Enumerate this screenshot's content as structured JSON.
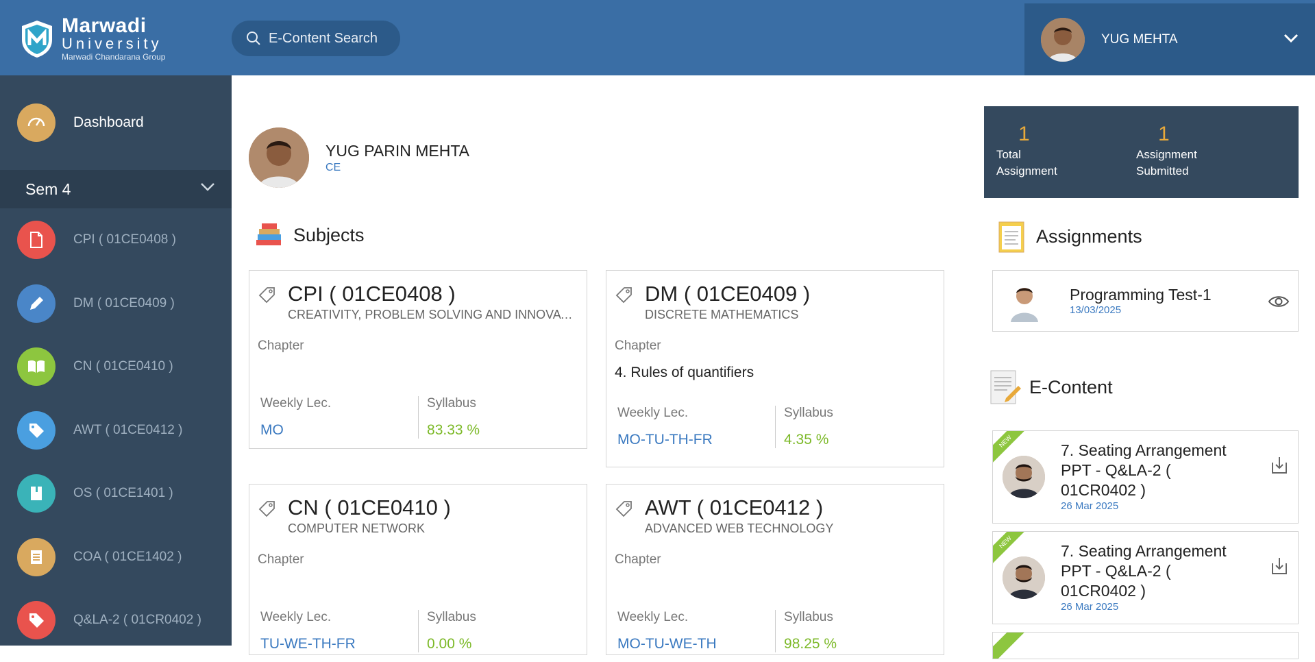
{
  "brand": {
    "name": "Marwadi",
    "subname": "University",
    "group": "Marwadi Chandarana Group"
  },
  "search": {
    "label": "E-Content Search"
  },
  "user_menu": {
    "name": "YUG MEHTA"
  },
  "sidebar": {
    "dashboard_label": "Dashboard",
    "semester_label": "Sem 4",
    "subjects": [
      {
        "label": "CPI ( 01CE0408 )",
        "color": "#e9534d",
        "icon": "document-icon"
      },
      {
        "label": "DM ( 01CE0409 )",
        "color": "#4a86c8",
        "icon": "pencil-icon"
      },
      {
        "label": "CN ( 01CE0410 )",
        "color": "#8dc63f",
        "icon": "book-icon"
      },
      {
        "label": "AWT ( 01CE0412 )",
        "color": "#4a9fe0",
        "icon": "tag-icon"
      },
      {
        "label": "OS ( 01CE1401 )",
        "color": "#3ab3b8",
        "icon": "notebook-icon"
      },
      {
        "label": "COA ( 01CE1402 )",
        "color": "#d9a95f",
        "icon": "list-icon"
      },
      {
        "label": "Q&LA-2 ( 01CR0402 )",
        "color": "#e9534d",
        "icon": "tag-icon"
      }
    ]
  },
  "profile": {
    "name": "YUG PARIN MEHTA",
    "department": "CE"
  },
  "subjects_section": {
    "title": "Subjects"
  },
  "subject_cards": [
    {
      "code": "CPI ( 01CE0408 )",
      "name": "CREATIVITY, PROBLEM SOLVING AND INNOVATI...",
      "chapter_label": "Chapter",
      "chapter": "",
      "weekly_label": "Weekly Lec.",
      "weekly": "MO",
      "syllabus_label": "Syllabus",
      "syllabus": "83.33 %"
    },
    {
      "code": "DM ( 01CE0409 )",
      "name": "DISCRETE MATHEMATICS",
      "chapter_label": "Chapter",
      "chapter": "4. Rules of quantifiers",
      "weekly_label": "Weekly Lec.",
      "weekly": "MO-TU-TH-FR",
      "syllabus_label": "Syllabus",
      "syllabus": "4.35 %"
    },
    {
      "code": "CN ( 01CE0410 )",
      "name": "COMPUTER NETWORK",
      "chapter_label": "Chapter",
      "chapter": "",
      "weekly_label": "Weekly Lec.",
      "weekly": "TU-WE-TH-FR",
      "syllabus_label": "Syllabus",
      "syllabus": "0.00 %"
    },
    {
      "code": "AWT ( 01CE0412 )",
      "name": "ADVANCED WEB TECHNOLOGY",
      "chapter_label": "Chapter",
      "chapter": "",
      "weekly_label": "Weekly Lec.",
      "weekly": "MO-TU-WE-TH",
      "syllabus_label": "Syllabus",
      "syllabus": "98.25 %"
    }
  ],
  "stats": {
    "total_assignment": {
      "value": "1",
      "label_line1": "Total",
      "label_line2": "Assignment"
    },
    "assignment_submitted": {
      "value": "1",
      "label_line1": "Assignment",
      "label_line2": "Submitted"
    }
  },
  "assignments_section": {
    "title": "Assignments"
  },
  "assignments": [
    {
      "title": "Programming Test-1",
      "date": "13/03/2025"
    }
  ],
  "econtent_section": {
    "title": "E-Content"
  },
  "econtent": [
    {
      "badge": "NEW",
      "title": "7. Seating Arrangement PPT - Q&LA-2 ( 01CR0402 )",
      "date": "26 Mar 2025"
    },
    {
      "badge": "NEW",
      "title": "7. Seating Arrangement PPT - Q&LA-2 ( 01CR0402 )",
      "date": "26 Mar 2025"
    }
  ]
}
